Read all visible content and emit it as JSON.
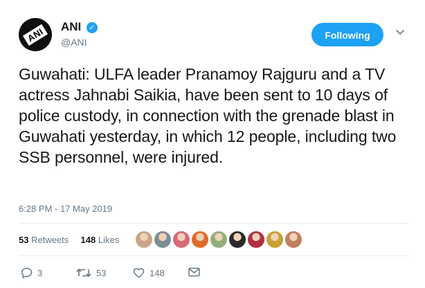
{
  "author": {
    "logo_text": "ANI",
    "name": "ANI",
    "handle": "@ANI",
    "verified": true
  },
  "follow_button": {
    "label": "Following"
  },
  "tweet": {
    "text": "Guwahati: ULFA leader Pranamoy Rajguru and a TV actress Jahnabi Saikia, have been sent to 10 days of police custody, in connection with the grenade blast in Guwahati yesterday, in which 12 people, including two SSB personnel, were injured.",
    "timestamp": "6:28 PM - 17 May 2019"
  },
  "stats": {
    "retweets_count": "53",
    "retweets_label": "Retweets",
    "likes_count": "148",
    "likes_label": "Likes"
  },
  "likers": [
    "#c8a58a",
    "#7d8e94",
    "#d86a7a",
    "#e06a2a",
    "#8fb07a",
    "#2b2b2b",
    "#b03040",
    "#c9a030",
    "#c08060"
  ],
  "actions": {
    "reply_count": "3",
    "retweet_count": "53",
    "like_count": "148"
  },
  "colors": {
    "accent": "#1da1f2",
    "muted": "#657786"
  }
}
